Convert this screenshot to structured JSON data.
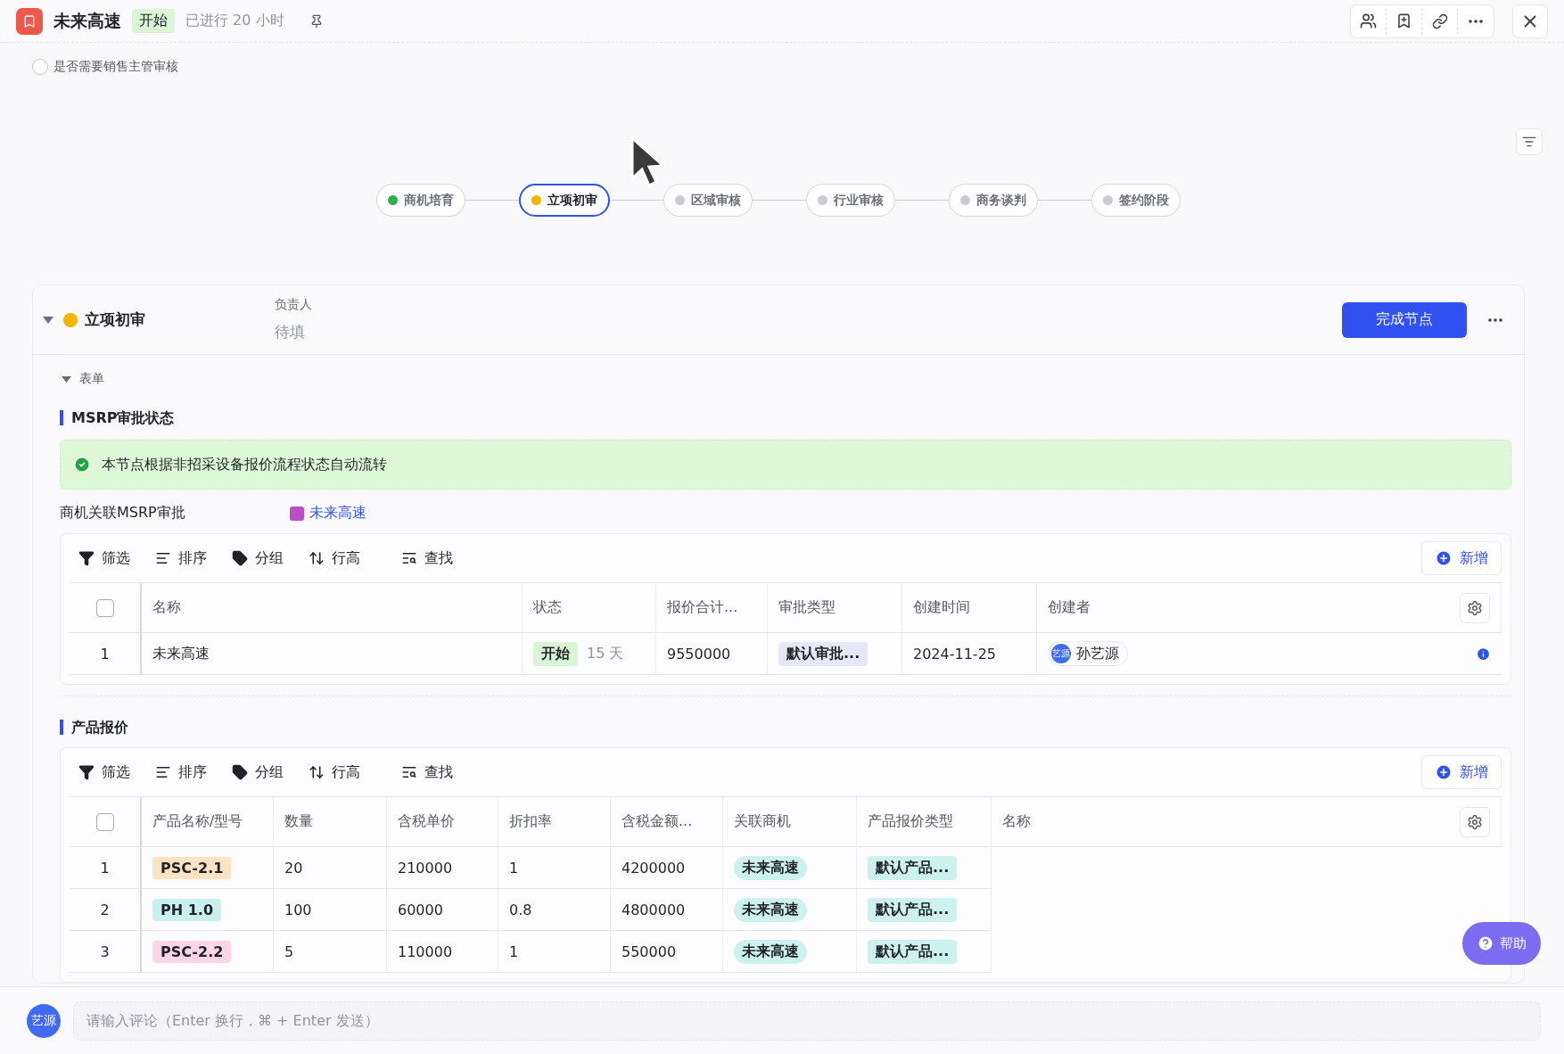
{
  "header": {
    "title": "未来高速",
    "status": "开始",
    "elapsed": "已进行 20 小时"
  },
  "review_toggle": {
    "label": "是否需要销售主管审核",
    "checked": false
  },
  "stages": [
    {
      "label": "商机培育",
      "color": "#2bb24c",
      "selected": false
    },
    {
      "label": "立项初审",
      "color": "#f5b400",
      "selected": true
    },
    {
      "label": "区域审核",
      "color": "#c9cbd3",
      "selected": false
    },
    {
      "label": "行业审核",
      "color": "#c9cbd3",
      "selected": false
    },
    {
      "label": "商务谈判",
      "color": "#c9cbd3",
      "selected": false
    },
    {
      "label": "签约阶段",
      "color": "#c9cbd3",
      "selected": false
    }
  ],
  "node": {
    "title": "立项初审",
    "color": "#f5b400",
    "expanded": true,
    "owner_label": "负责人",
    "owner_value": "待填",
    "complete_button": "完成节点"
  },
  "form": {
    "label": "表单",
    "expanded": true
  },
  "msrp": {
    "title": "MSRP审批状态",
    "notice": "本节点根据非招采设备报价流程状态自动流转",
    "link_label": "商机关联MSRP审批",
    "link_value": "未来高速",
    "toolbar": [
      "筛选",
      "排序",
      "分组",
      "行高",
      "查找"
    ],
    "add_button": "新增",
    "select_all_checked": false,
    "columns": [
      "名称",
      "状态",
      "报价合计...",
      "审批类型",
      "创建时间",
      "创建者"
    ],
    "rows": [
      {
        "index": "1",
        "name": "未来高速",
        "status": "开始",
        "duration": "15 天",
        "total": "9550000",
        "type": "默认审批...",
        "created": "2024-11-25",
        "creator_avatar": "艺源",
        "creator": "孙艺源"
      }
    ]
  },
  "quotes": {
    "title": "产品报价",
    "toolbar": [
      "筛选",
      "排序",
      "分组",
      "行高",
      "查找"
    ],
    "add_button": "新增",
    "select_all_checked": false,
    "columns": [
      "产品名称/型号",
      "数量",
      "含税单价",
      "折扣率",
      "含税金额...",
      "关联商机",
      "产品报价类型",
      "名称"
    ],
    "rows": [
      {
        "index": "1",
        "product": "PSC-2.1",
        "color": "#fde2c4",
        "qty": "20",
        "price": "210000",
        "discount": "1",
        "amount": "4200000",
        "opportunity": "未来高速",
        "type": "默认产品..."
      },
      {
        "index": "2",
        "product": "PH 1.0",
        "color": "#c9f0ee",
        "qty": "100",
        "price": "60000",
        "discount": "0.8",
        "amount": "4800000",
        "opportunity": "未来高速",
        "type": "默认产品..."
      },
      {
        "index": "3",
        "product": "PSC-2.2",
        "color": "#fcd6e6",
        "qty": "5",
        "price": "110000",
        "discount": "1",
        "amount": "550000",
        "opportunity": "未来高速",
        "type": "默认产品..."
      }
    ]
  },
  "help_button": "帮助",
  "comment": {
    "avatar": "艺源",
    "placeholder": "请输入评论（Enter 换行，⌘ + Enter 发送）"
  }
}
